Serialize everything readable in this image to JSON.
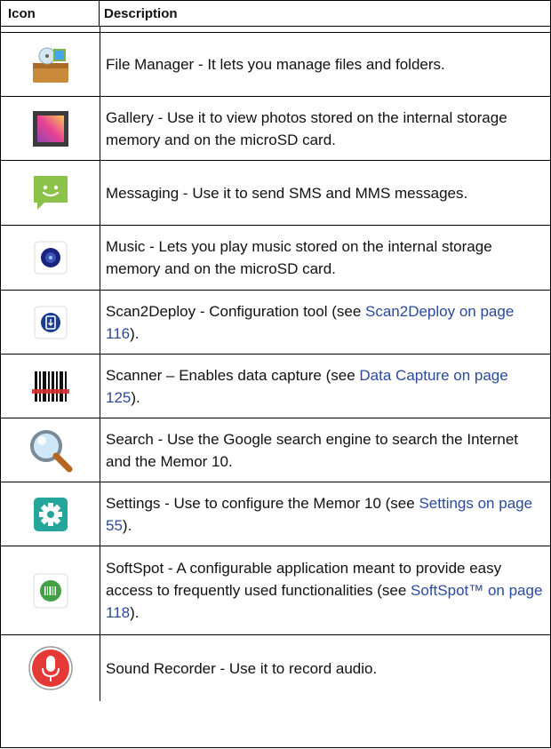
{
  "header": {
    "icon_col": "Icon",
    "desc_col": "Description"
  },
  "rows": [
    {
      "icon": "file-manager-icon",
      "text": "File Manager - It lets you manage files and folders.",
      "link": "",
      "tail": ""
    },
    {
      "icon": "gallery-icon",
      "text": "Gallery - Use it to view photos stored on the internal storage memory and on the microSD card.",
      "link": "",
      "tail": ""
    },
    {
      "icon": "messaging-icon",
      "text": "Messaging - Use it to send SMS and MMS messages.",
      "link": "",
      "tail": ""
    },
    {
      "icon": "music-icon",
      "text": "Music - Lets you play music stored on the internal storage memory and on the microSD card.",
      "link": "",
      "tail": ""
    },
    {
      "icon": "scan2deploy-icon",
      "text": "Scan2Deploy - Configuration tool (see ",
      "link": "Scan2Deploy on page 116",
      "tail": ")."
    },
    {
      "icon": "scanner-icon",
      "text": "Scanner – Enables data capture (see ",
      "link": "Data Capture on page 125",
      "tail": ")."
    },
    {
      "icon": "search-icon",
      "text": "Search - Use the Google search engine to search the Internet and the Memor 10.",
      "link": "",
      "tail": ""
    },
    {
      "icon": "settings-icon",
      "text": "Settings - Use to configure the Memor 10 (see ",
      "link": "Settings on page 55",
      "tail": ")."
    },
    {
      "icon": "softspot-icon",
      "text": "SoftSpot - A configurable application meant to provide easy access to frequently used functionalities (see ",
      "link": "SoftSpot™ on page 118",
      "tail": ")."
    },
    {
      "icon": "sound-recorder-icon",
      "text": "Sound Recorder - Use it to record audio.",
      "link": "",
      "tail": ""
    }
  ],
  "colors": {
    "link": "#2a4a9a",
    "border": "#000000"
  }
}
